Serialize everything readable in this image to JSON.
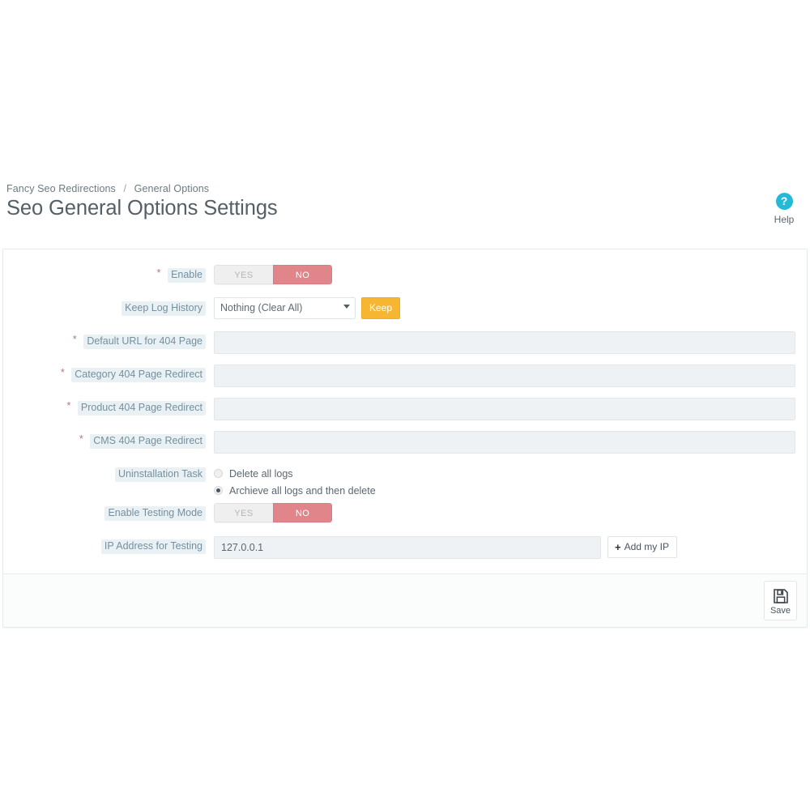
{
  "header": {
    "breadcrumb": {
      "root": "Fancy Seo Redirections",
      "separator": "/",
      "current": "General Options"
    },
    "title": "Seo General Options Settings",
    "help": {
      "icon": "question-mark-circle-icon",
      "glyph": "?",
      "label": "Help",
      "color": "#25b9d7"
    }
  },
  "form": {
    "rows": [
      {
        "label": "Enable",
        "required": true,
        "type": "switch",
        "off_label": "YES",
        "on_label": "NO",
        "value": "NO"
      },
      {
        "label": "Keep Log History",
        "required": false,
        "type": "select",
        "selected": "Nothing (Clear All)",
        "button_label": "Keep",
        "button_color": "#f6b632"
      },
      {
        "label": "Default URL for 404 Page",
        "required": true,
        "type": "text",
        "value": "",
        "placeholder": ""
      },
      {
        "label": "Category 404 Page Redirect",
        "required": true,
        "type": "text",
        "value": "",
        "placeholder": ""
      },
      {
        "label": "Product 404 Page Redirect",
        "required": true,
        "type": "text",
        "value": "",
        "placeholder": ""
      },
      {
        "label": "CMS 404 Page Redirect",
        "required": true,
        "type": "text",
        "value": "",
        "placeholder": ""
      },
      {
        "label": "Uninstallation Task",
        "required": false,
        "type": "radio",
        "options": [
          {
            "text": "Delete all logs",
            "checked": false
          },
          {
            "text": "Archieve all logs and then delete",
            "checked": true
          }
        ]
      },
      {
        "label": "Enable Testing Mode",
        "required": false,
        "type": "switch",
        "off_label": "YES",
        "on_label": "NO",
        "value": "NO"
      },
      {
        "label": "IP Address for Testing",
        "required": false,
        "type": "text_with_button",
        "value": "127.0.0.1",
        "placeholder": "",
        "button_label": "Add my IP",
        "button_icon": "plus-icon",
        "button_glyph": "+"
      }
    ]
  },
  "footer": {
    "save": {
      "label": "Save",
      "icon": "floppy-disk-save-icon"
    }
  },
  "theme": {
    "label_text": "#74909f",
    "label_highlight": "#eaf1f4",
    "required_star": "#b5797b",
    "switch_active": "#e0868b",
    "input_fill": "#eef2f4",
    "accent_orange": "#f6b632",
    "help_blue": "#25b9d7"
  }
}
